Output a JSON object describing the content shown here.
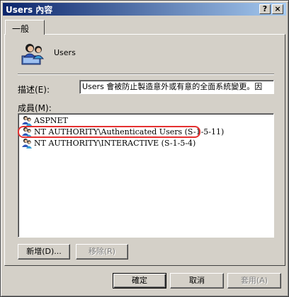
{
  "window": {
    "title": "Users 內容",
    "help_glyph": "?",
    "close_glyph": "×"
  },
  "tabs": [
    {
      "label": "一般"
    }
  ],
  "group": {
    "icon": "group-users-icon",
    "name": "Users"
  },
  "description": {
    "label": "描述(E):",
    "value": "Users 會被防止製造意外或有意的全面系統變更。因"
  },
  "members": {
    "label": "成員(M):",
    "items": [
      {
        "icon": "group-users-icon",
        "name": "ASPNET"
      },
      {
        "icon": "group-users-icon",
        "name": "NT AUTHORITY\\Authenticated Users (S-1-5-11)",
        "highlighted": true
      },
      {
        "icon": "group-users-icon",
        "name": "NT AUTHORITY\\INTERACTIVE (S-1-5-4)"
      }
    ]
  },
  "buttons": {
    "add": "新增(D)...",
    "remove": "移除(R)",
    "ok": "確定",
    "cancel": "取消",
    "apply": "套用(A)"
  },
  "colors": {
    "titlebar_start": "#0a246a",
    "titlebar_end": "#a6caf0",
    "highlight_ring": "#e53030"
  }
}
